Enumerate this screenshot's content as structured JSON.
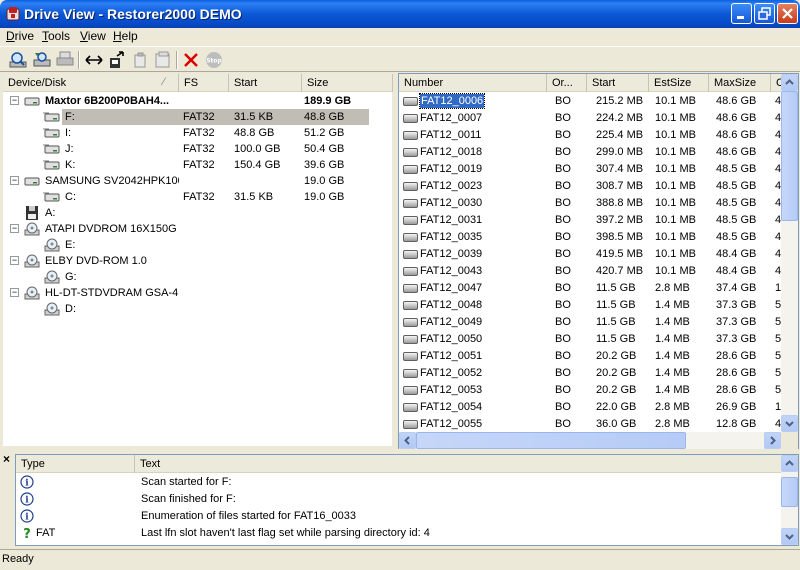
{
  "window": {
    "title": "Drive View - Restorer2000 DEMO",
    "icon": "restorer-app-icon",
    "controls": [
      "minimize",
      "maximize",
      "close"
    ]
  },
  "menu": [
    "Drive",
    "Tools",
    "View",
    "Help"
  ],
  "toolbar": {
    "buttons": [
      "scan-icon",
      "open-image-icon",
      "print-icon",
      "swap-icon",
      "export-icon",
      "copy-icon",
      "save-icon",
      "delete-icon",
      "stop-icon"
    ]
  },
  "tree": {
    "columns": [
      "Device/Disk",
      "FS",
      "Start",
      "Size"
    ],
    "rows": [
      {
        "name": "Maxtor 6B200P0BAH4...",
        "fs": "",
        "start": "",
        "size": "189.9 GB",
        "bold": true
      },
      {
        "name": "F:",
        "fs": "FAT32",
        "start": "31.5 KB",
        "size": "48.8 GB",
        "selected": true
      },
      {
        "name": "I:",
        "fs": "FAT32",
        "start": "48.8 GB",
        "size": "51.2 GB"
      },
      {
        "name": "J:",
        "fs": "FAT32",
        "start": "100.0 GB",
        "size": "50.4 GB"
      },
      {
        "name": "K:",
        "fs": "FAT32",
        "start": "150.4 GB",
        "size": "39.6 GB"
      },
      {
        "name": "SAMSUNG SV2042HPK100...",
        "fs": "",
        "start": "",
        "size": "19.0 GB"
      },
      {
        "name": "C:",
        "fs": "FAT32",
        "start": "31.5 KB",
        "size": "19.0 GB"
      },
      {
        "name": "A:",
        "fs": "",
        "start": "",
        "size": ""
      },
      {
        "name": "ATAPI DVDROM 16X150G",
        "fs": "",
        "start": "",
        "size": ""
      },
      {
        "name": "E:",
        "fs": "",
        "start": "",
        "size": ""
      },
      {
        "name": "ELBY DVD-ROM 1.0",
        "fs": "",
        "start": "",
        "size": ""
      },
      {
        "name": "G:",
        "fs": "",
        "start": "",
        "size": ""
      },
      {
        "name": "HL-DT-STDVDRAM GSA-4...",
        "fs": "",
        "start": "",
        "size": ""
      },
      {
        "name": "D:",
        "fs": "",
        "start": "",
        "size": ""
      }
    ]
  },
  "files": {
    "columns": [
      "Number",
      "Or...",
      "Start",
      "EstSize",
      "MaxSize",
      "C"
    ],
    "rows": [
      {
        "number": "FAT12_0006",
        "or": "BO",
        "start": "215.2 MB",
        "est": "10.1 MB",
        "max": "48.6 GB",
        "c": "4"
      },
      {
        "number": "FAT12_0007",
        "or": "BO",
        "start": "224.2 MB",
        "est": "10.1 MB",
        "max": "48.6 GB",
        "c": "4"
      },
      {
        "number": "FAT12_0011",
        "or": "BO",
        "start": "225.4 MB",
        "est": "10.1 MB",
        "max": "48.6 GB",
        "c": "4"
      },
      {
        "number": "FAT12_0018",
        "or": "BO",
        "start": "299.0 MB",
        "est": "10.1 MB",
        "max": "48.6 GB",
        "c": "4"
      },
      {
        "number": "FAT12_0019",
        "or": "BO",
        "start": "307.4 MB",
        "est": "10.1 MB",
        "max": "48.5 GB",
        "c": "4"
      },
      {
        "number": "FAT12_0023",
        "or": "BO",
        "start": "308.7 MB",
        "est": "10.1 MB",
        "max": "48.5 GB",
        "c": "4"
      },
      {
        "number": "FAT12_0030",
        "or": "BO",
        "start": "388.8 MB",
        "est": "10.1 MB",
        "max": "48.5 GB",
        "c": "4"
      },
      {
        "number": "FAT12_0031",
        "or": "BO",
        "start": "397.2 MB",
        "est": "10.1 MB",
        "max": "48.5 GB",
        "c": "4"
      },
      {
        "number": "FAT12_0035",
        "or": "BO",
        "start": "398.5 MB",
        "est": "10.1 MB",
        "max": "48.5 GB",
        "c": "4"
      },
      {
        "number": "FAT12_0039",
        "or": "BO",
        "start": "419.5 MB",
        "est": "10.1 MB",
        "max": "48.4 GB",
        "c": "4"
      },
      {
        "number": "FAT12_0043",
        "or": "BO",
        "start": "420.7 MB",
        "est": "10.1 MB",
        "max": "48.4 GB",
        "c": "4"
      },
      {
        "number": "FAT12_0047",
        "or": "BO",
        "start": "11.5 GB",
        "est": "2.8 MB",
        "max": "37.4 GB",
        "c": "1"
      },
      {
        "number": "FAT12_0048",
        "or": "BO",
        "start": "11.5 GB",
        "est": "1.4 MB",
        "max": "37.3 GB",
        "c": "5"
      },
      {
        "number": "FAT12_0049",
        "or": "BO",
        "start": "11.5 GB",
        "est": "1.4 MB",
        "max": "37.3 GB",
        "c": "5"
      },
      {
        "number": "FAT12_0050",
        "or": "BO",
        "start": "11.5 GB",
        "est": "1.4 MB",
        "max": "37.3 GB",
        "c": "5"
      },
      {
        "number": "FAT12_0051",
        "or": "BO",
        "start": "20.2 GB",
        "est": "1.4 MB",
        "max": "28.6 GB",
        "c": "5"
      },
      {
        "number": "FAT12_0052",
        "or": "BO",
        "start": "20.2 GB",
        "est": "1.4 MB",
        "max": "28.6 GB",
        "c": "5"
      },
      {
        "number": "FAT12_0053",
        "or": "BO",
        "start": "20.2 GB",
        "est": "1.4 MB",
        "max": "28.6 GB",
        "c": "5"
      },
      {
        "number": "FAT12_0054",
        "or": "BO",
        "start": "22.0 GB",
        "est": "2.8 MB",
        "max": "26.9 GB",
        "c": "1"
      },
      {
        "number": "FAT12_0055",
        "or": "BO",
        "start": "36.0 GB",
        "est": "2.8 MB",
        "max": "12.8 GB",
        "c": "4"
      }
    ]
  },
  "log": {
    "close": "×",
    "columns": [
      "Type",
      "Text"
    ],
    "rows": [
      {
        "icon": "info-icon",
        "type": "",
        "text": "Scan started for F:"
      },
      {
        "icon": "info-icon",
        "type": "",
        "text": "Scan finished for F:"
      },
      {
        "icon": "info-icon",
        "type": "",
        "text": "Enumeration of files started for FAT16_0033"
      },
      {
        "icon": "question-icon",
        "type": "FAT",
        "text": "Last lfn slot haven't last flag set while parsing directory id: 4"
      }
    ]
  },
  "status": "Ready",
  "colors": {
    "titlebar": "#0b58d6",
    "selection": "#316ac5",
    "tree_selection": "#c0bdb4",
    "face": "#ece9d8"
  }
}
